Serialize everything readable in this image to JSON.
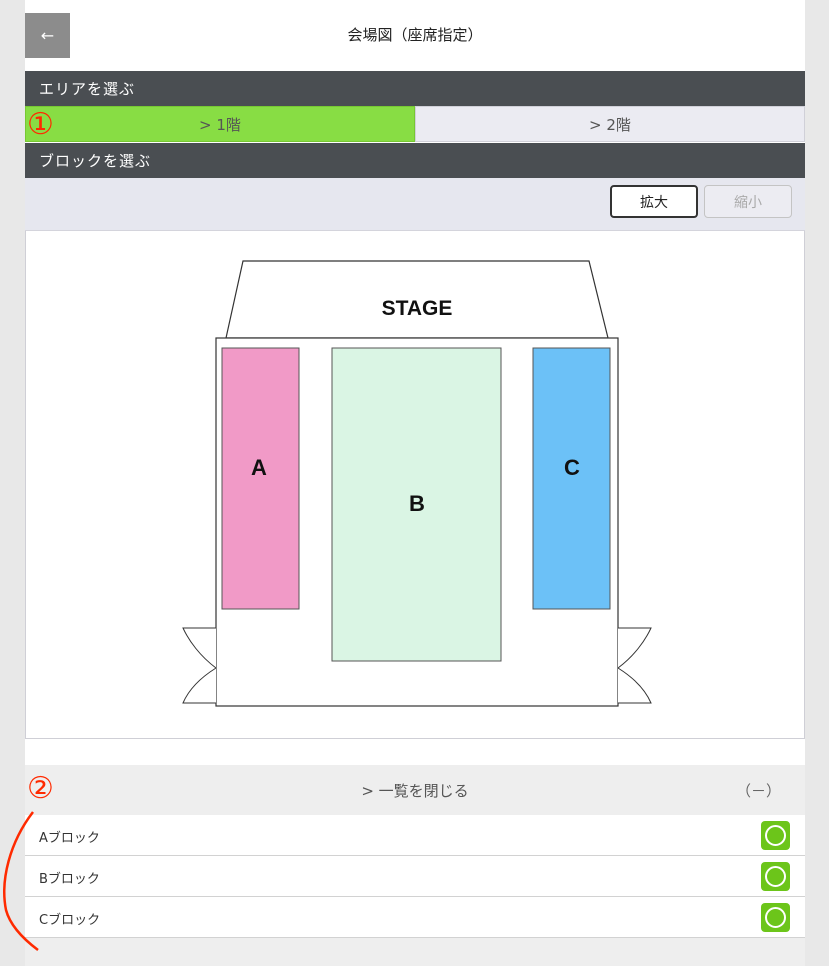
{
  "header": {
    "title": "会場図（座席指定）",
    "back_icon": "←"
  },
  "area_section": {
    "heading": "エリアを選ぶ",
    "tabs": [
      {
        "label": "> 1階",
        "selected": true
      },
      {
        "label": "> 2階",
        "selected": false
      }
    ]
  },
  "block_section": {
    "heading": "ブロックを選ぶ"
  },
  "zoom": {
    "zoom_in_label": "拡大",
    "zoom_out_label": "縮小"
  },
  "seat_map": {
    "stage_label": "STAGE",
    "blocks": [
      {
        "label": "A",
        "color": "#f19ac7"
      },
      {
        "label": "B",
        "color": "#daf5e4"
      },
      {
        "label": "C",
        "color": "#6cc1f7"
      }
    ]
  },
  "block_list": {
    "toggle_label": "> 一覧を閉じる",
    "collapse_indicator": "（－）",
    "items": [
      {
        "label": "Aブロック",
        "status": "available-circle-icon"
      },
      {
        "label": "Bブロック",
        "status": "available-circle-icon"
      },
      {
        "label": "Cブロック",
        "status": "available-circle-icon"
      }
    ]
  },
  "annotations": {
    "marker_1": "①",
    "marker_2": "②",
    "accent_color": "#ff2a00"
  },
  "colors": {
    "selected_tab": "#88dd44",
    "section_header": "#4a4e52",
    "available": "#6cc51a"
  }
}
